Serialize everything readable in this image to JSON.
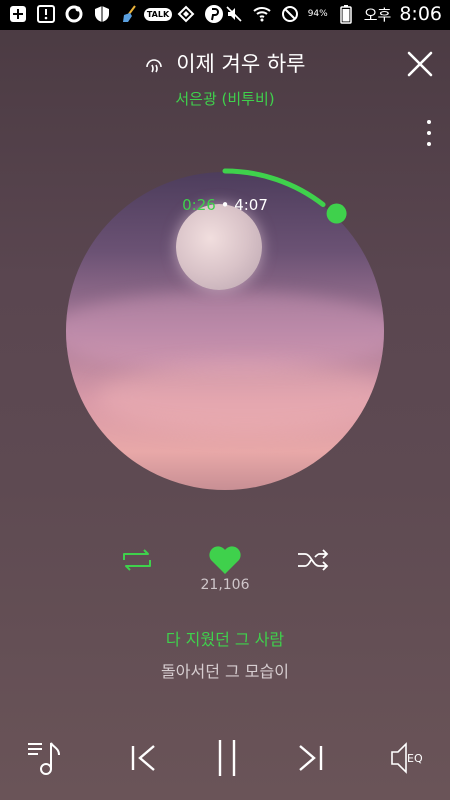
{
  "status_bar": {
    "talk_label": "TALK",
    "battery": "94%",
    "ampm": "오후",
    "time": "8:06"
  },
  "header": {
    "song_title": "이제 겨우 하루",
    "artist": "서은광 (비투비)"
  },
  "player": {
    "current_time": "0:26",
    "separator": "•",
    "total_time": "4:07",
    "progress_fraction": 0.105,
    "likes": "21,106"
  },
  "lyrics": {
    "current_line": "다 지웠던 그 사람",
    "next_line": "돌아서던 그 모습이"
  },
  "bottom_bar": {
    "eq_label": "EQ"
  },
  "colors": {
    "accent": "#3fd14c",
    "text": "#ffffff"
  },
  "icons": [
    "headphone-icon",
    "close-icon",
    "more-icon",
    "repeat-icon",
    "heart-icon",
    "shuffle-icon",
    "playlist-icon",
    "previous-icon",
    "pause-icon",
    "next-icon",
    "eq-speaker-icon"
  ]
}
